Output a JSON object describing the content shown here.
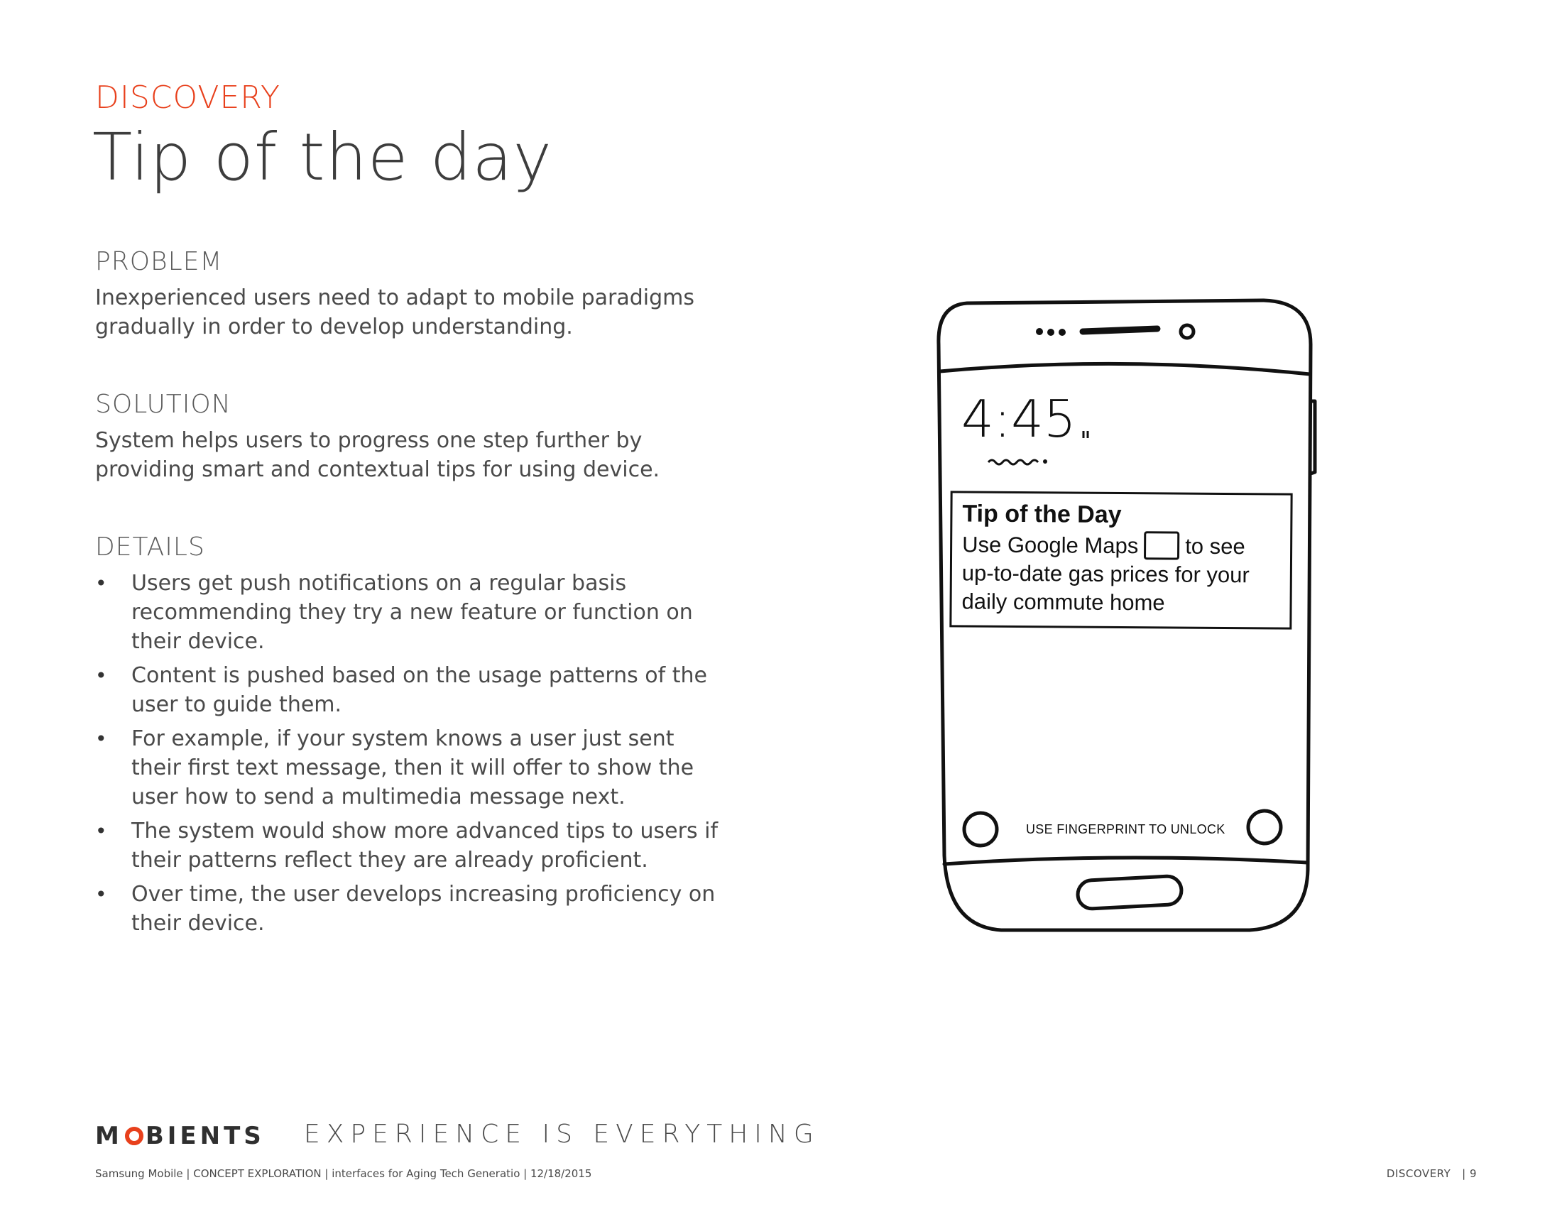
{
  "header": {
    "kicker": "DISCOVERY",
    "title": "Tip of the day"
  },
  "problem": {
    "heading": "PROBLEM",
    "body": "Inexperienced users need to adapt to mobile paradigms gradually in order to develop understanding."
  },
  "solution": {
    "heading": "SOLUTION",
    "body": "System helps users to progress one step further by providing smart and contextual tips for using device."
  },
  "details": {
    "heading": "DETAILS",
    "items": [
      "Users get push notifications on a regular basis recommending they try a new feature or function on their device.",
      "Content is pushed based on the usage patterns of the user to guide them.",
      "For example, if your system knows a user just sent their first text message, then it will offer to show the user how to send a multimedia message next.",
      "The system would show more advanced tips to users if their patterns reflect they are already proficient.",
      "Over time, the user develops increasing proficiency on their device."
    ],
    "bullet": "•"
  },
  "phone": {
    "clock": "4:45",
    "tip_title": "Tip of the Day",
    "tip_text_before": "Use Google Maps",
    "tip_text_after": "to see up-to-date gas prices for your daily commute home",
    "unlock_text": "USE FINGERPRINT TO UNLOCK"
  },
  "footer": {
    "logo_prefix": "M",
    "logo_suffix": "BIENTS",
    "tagline": "EXPERIENCE IS EVERYTHING",
    "meta": "Samsung Mobile | CONCEPT EXPLORATION | interfaces for Aging Tech Generatio | 12/18/2015",
    "page_section": "DISCOVERY",
    "page_number": "| 9"
  },
  "colors": {
    "accent": "#e8401c",
    "text": "#4a4a4a"
  }
}
